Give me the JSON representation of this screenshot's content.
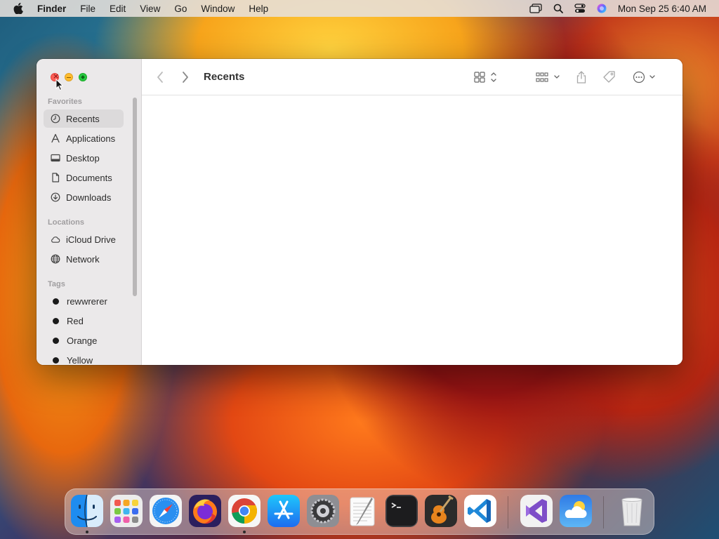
{
  "menubar": {
    "app_name": "Finder",
    "items": [
      "File",
      "Edit",
      "View",
      "Go",
      "Window",
      "Help"
    ],
    "clock": "Mon Sep 25  6:40 AM"
  },
  "window": {
    "title": "Recents"
  },
  "sidebar": {
    "favorites_label": "Favorites",
    "favorites": [
      {
        "label": "Recents",
        "icon": "clock-icon",
        "active": true
      },
      {
        "label": "Applications",
        "icon": "applications-icon"
      },
      {
        "label": "Desktop",
        "icon": "desktop-icon"
      },
      {
        "label": "Documents",
        "icon": "document-icon"
      },
      {
        "label": "Downloads",
        "icon": "download-icon"
      }
    ],
    "locations_label": "Locations",
    "locations": [
      {
        "label": "iCloud Drive",
        "icon": "cloud-icon"
      },
      {
        "label": "Network",
        "icon": "globe-icon"
      }
    ],
    "tags_label": "Tags",
    "tags": [
      {
        "label": "rewwrerer",
        "color": "#1a1a1a"
      },
      {
        "label": "Red",
        "color": "#1a1a1a"
      },
      {
        "label": "Orange",
        "color": "#1a1a1a"
      },
      {
        "label": "Yellow",
        "color": "#1a1a1a"
      }
    ]
  },
  "dock": {
    "apps": [
      {
        "name": "Finder",
        "icon": "finder-icon",
        "running": true
      },
      {
        "name": "Launchpad",
        "icon": "launchpad-icon"
      },
      {
        "name": "Safari",
        "icon": "safari-icon"
      },
      {
        "name": "Firefox",
        "icon": "firefox-icon"
      },
      {
        "name": "Google Chrome",
        "icon": "chrome-icon",
        "running": true
      },
      {
        "name": "App Store",
        "icon": "app-store-icon"
      },
      {
        "name": "System Settings",
        "icon": "system-settings-icon"
      },
      {
        "name": "TextEdit",
        "icon": "textedit-icon"
      },
      {
        "name": "Terminal",
        "icon": "terminal-icon"
      },
      {
        "name": "GarageBand",
        "icon": "garageband-icon"
      },
      {
        "name": "Visual Studio Code",
        "icon": "vscode-icon"
      },
      {
        "name": "Visual Studio",
        "icon": "visual-studio-icon"
      },
      {
        "name": "Weather",
        "icon": "weather-icon"
      },
      {
        "name": "Trash",
        "icon": "trash-icon"
      }
    ]
  },
  "colors": {
    "close": "#ff5f57",
    "minimize": "#febc2e",
    "maximize": "#28c840",
    "sidebar_bg": "#ebe9ea",
    "active_item_bg": "#dcdadb"
  }
}
